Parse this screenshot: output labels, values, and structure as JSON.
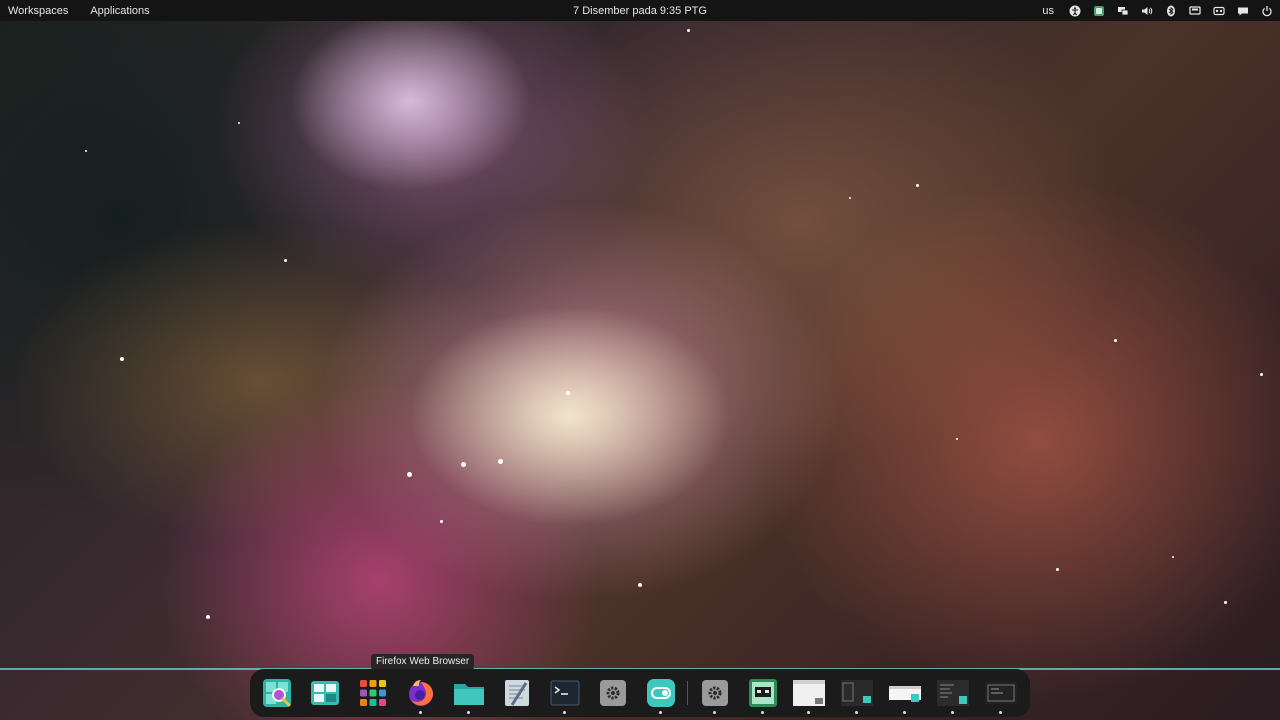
{
  "top_panel": {
    "workspaces_label": "Workspaces",
    "applications_label": "Applications",
    "clock": "7 Disember pada 9:35 PTG",
    "keyboard_layout": "us",
    "tray_icons": [
      "accessibility-icon",
      "app-indicator-icon",
      "display-icon",
      "volume-icon",
      "bluetooth-icon",
      "screen-icon",
      "battery-icon",
      "notifications-icon",
      "power-icon"
    ]
  },
  "dock": {
    "tooltip": "Firefox Web Browser",
    "items": [
      {
        "name": "search",
        "icon": "search-app-icon",
        "running": false
      },
      {
        "name": "workspaces",
        "icon": "workspace-grid-icon",
        "running": false
      },
      {
        "name": "applications",
        "icon": "app-grid-icon",
        "running": false
      },
      {
        "name": "firefox",
        "icon": "firefox-icon",
        "running": true
      },
      {
        "name": "files",
        "icon": "folder-icon",
        "running": true
      },
      {
        "name": "text-editor",
        "icon": "text-editor-icon",
        "running": false
      },
      {
        "name": "terminal",
        "icon": "terminal-icon",
        "running": true
      },
      {
        "name": "settings",
        "icon": "settings-icon",
        "running": false
      },
      {
        "name": "toggle-app",
        "icon": "toggle-app-icon",
        "running": true
      },
      {
        "name": "settings-running",
        "icon": "settings-icon",
        "running": true
      },
      {
        "name": "game-app",
        "icon": "game-app-icon",
        "running": true
      },
      {
        "name": "window-1",
        "icon": "window-thumbnail-icon",
        "running": true
      },
      {
        "name": "window-2",
        "icon": "window-thumbnail-icon",
        "running": true
      },
      {
        "name": "window-3",
        "icon": "window-thumbnail-icon",
        "running": true
      },
      {
        "name": "window-4",
        "icon": "window-thumbnail-icon",
        "running": true
      },
      {
        "name": "window-5",
        "icon": "window-thumbnail-icon",
        "running": true
      }
    ]
  }
}
